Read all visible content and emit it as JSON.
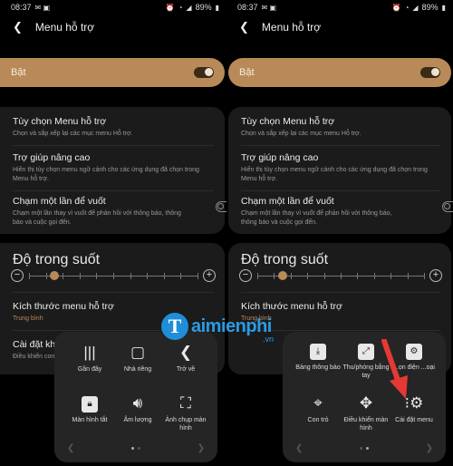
{
  "status": {
    "time": "08:37",
    "battery": "89%"
  },
  "header": {
    "back_icon": "chevron-left",
    "title": "Menu hỗ trợ"
  },
  "master": {
    "label": "Bật",
    "on": true
  },
  "settings": {
    "options": {
      "title": "Tùy chọn Menu hỗ trợ",
      "sub": "Chọn và sắp xếp lại các mục menu Hỗ trợ."
    },
    "advanced": {
      "title": "Trợ giúp nâng cao",
      "sub": "Hiển thị tùy chọn menu ngữ cảnh cho các ứng dụng đã chọn trong Menu hỗ trợ."
    },
    "tap": {
      "title": "Chạm một lần để vuốt",
      "sub": "Chạm một lần thay vì vuốt để phản hồi với thông báo, thông báo và cuộc gọi đến.",
      "on": false
    },
    "transparency": {
      "title": "Độ trong suốt",
      "level": 0.15
    },
    "size": {
      "title": "Kích thước menu hỗ trợ",
      "value": "Trung bình"
    },
    "more": {
      "title_left": "Cài đặt khá",
      "sub_left": "Điều khiển con"
    }
  },
  "menu_left": [
    {
      "icon": "bars",
      "label": "Gần đây"
    },
    {
      "icon": "square",
      "label": "Nhà riêng"
    },
    {
      "icon": "back",
      "label": "Trở về"
    },
    {
      "icon": "lock",
      "label": "Màn hình tắt"
    },
    {
      "icon": "speaker",
      "label": "Âm lượng"
    },
    {
      "icon": "screenshot",
      "label": "Ảnh chụp màn hình"
    }
  ],
  "menu_right": [
    {
      "icon": "download",
      "label": "Bảng thông báo"
    },
    {
      "icon": "zoom",
      "label": "Thu/phóng bằng tay"
    },
    {
      "icon": "settings",
      "label": "...ọn điện ...oại"
    },
    {
      "icon": "pointer",
      "label": "Con trỏ"
    },
    {
      "icon": "dpad",
      "label": "Điều khiển màn hình"
    },
    {
      "icon": "dots-gear",
      "label": "Cài đặt menu"
    }
  ],
  "watermark": {
    "letter": "T",
    "text": "aimienphi",
    "suffix": ".vn"
  },
  "colors": {
    "accent": "#b88a58",
    "arrow": "#e53935"
  }
}
